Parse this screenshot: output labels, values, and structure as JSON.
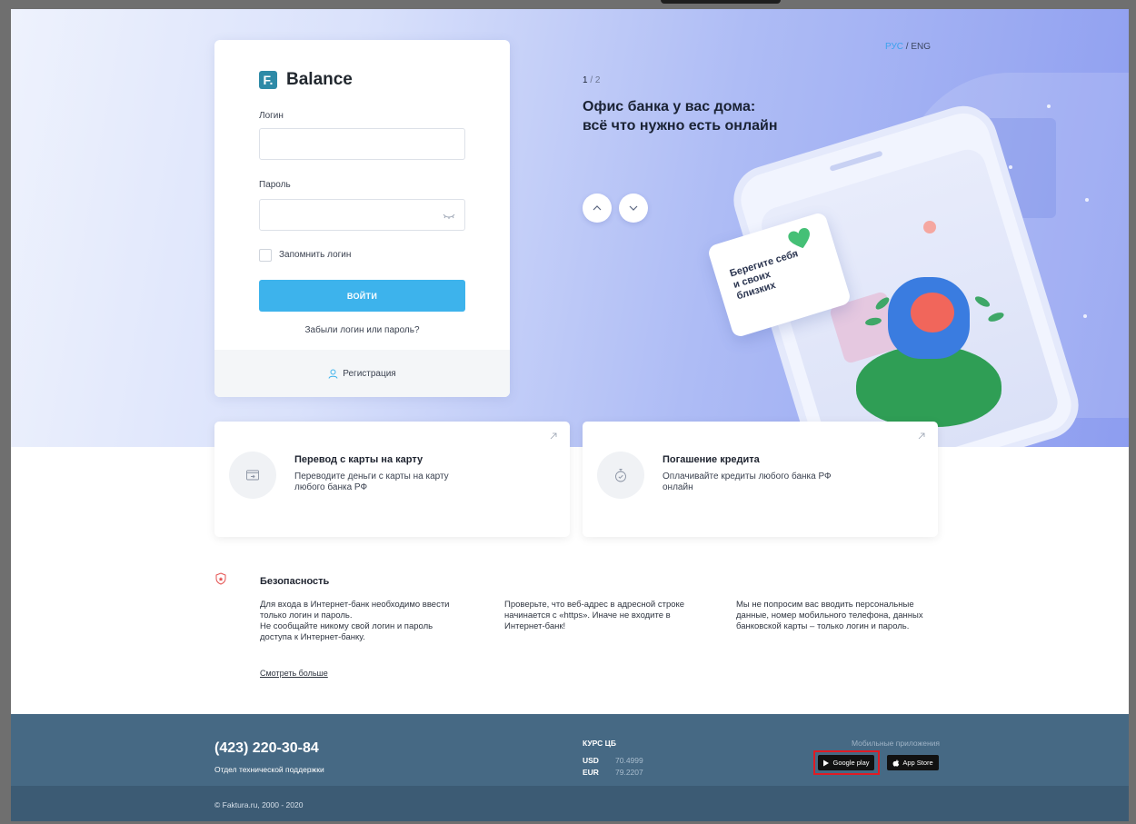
{
  "header": {
    "lang_active": "РУС",
    "lang_sep": " / ",
    "lang_other": "ENG"
  },
  "login": {
    "brand": "Balance",
    "brand_mark": "F.",
    "login_label": "Логин",
    "login_value": "",
    "password_label": "Пароль",
    "password_value": "",
    "remember_label": "Запомнить логин",
    "remember_checked": false,
    "submit_label": "ВОЙТИ",
    "forgot_label": "Забыли логин или пароль?",
    "register_label": "Регистрация"
  },
  "slider": {
    "current": "1",
    "total": "/ 2",
    "title_line1": "Офис банка у вас дома:",
    "title_line2": "всё что нужно есть онлайн",
    "illustration_text": "Берегите себя и своих близких"
  },
  "services": [
    {
      "title": "Перевод с карты на карту",
      "desc": "Переводите деньги с карты на карту любого банка РФ",
      "icon": "card-transfer-icon"
    },
    {
      "title": "Погашение кредита",
      "desc": "Оплачивайте кредиты любого банка РФ онлайн",
      "icon": "stopwatch-icon"
    }
  ],
  "security": {
    "title": "Безопасность",
    "col1": "Для входа в Интернет-банк необходимо ввести только логин и пароль.\nНе сообщайте никому свой логин и пароль доступа к Интернет-банку.",
    "col2": "Проверьте, что веб-адрес в адресной строке начинается с «https». Иначе не входите в Интернет-банк!",
    "col3": "Мы не попросим вас вводить персональные данные, номер мобильного телефона, данных банковской карты – только логин и пароль.",
    "more_label": "Смотреть больше"
  },
  "footer": {
    "phone": "(423) 220-30-84",
    "support_label": "Отдел технической поддержки",
    "rates_title": "КУРС ЦБ",
    "rates": [
      {
        "code": "USD",
        "value": "70.4999"
      },
      {
        "code": "EUR",
        "value": "79.2207"
      }
    ],
    "mobile_label": "Мобильные приложения",
    "google_play": "Google play",
    "app_store": "App Store",
    "copyright": "© Faktura.ru, 2000 - 2020"
  },
  "colors": {
    "accent": "#3db3ec",
    "footer": "#466984",
    "footer_bottom": "#3c5b74",
    "highlight": "#e01b24"
  }
}
